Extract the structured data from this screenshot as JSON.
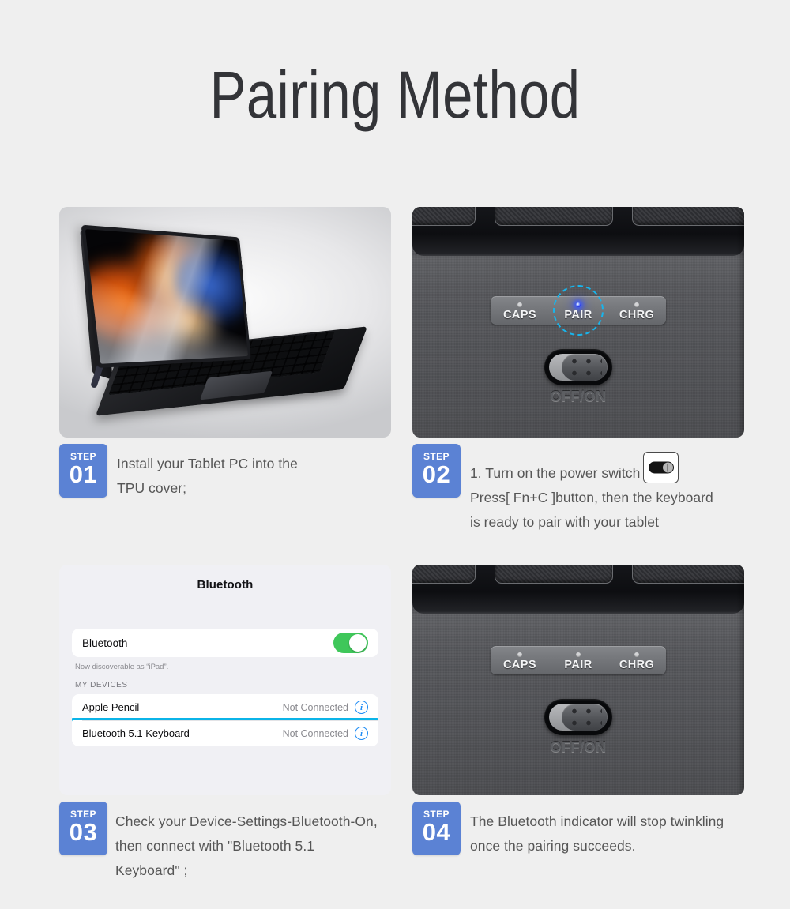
{
  "page": {
    "title": "Pairing Method",
    "background_color": "#efefef",
    "accent_color": "#5b82d4",
    "highlight_color": "#0bb4e8"
  },
  "steps": [
    {
      "badge_word": "STEP",
      "badge_number": "01",
      "caption_lines": [
        "Install your Tablet PC into the",
        "TPU cover;"
      ],
      "media": "tablet-in-keyboard-case-photo"
    },
    {
      "badge_word": "STEP",
      "badge_number": "02",
      "caption_part1": "1. Turn on the power switch",
      "caption_part2": "Press[ Fn+C ]button, then the keyboard",
      "caption_part3": "is ready to pair with your tablet",
      "media": "keyboard-indicator-macro-photo-pairing"
    },
    {
      "badge_word": "STEP",
      "badge_number": "03",
      "caption_lines": [
        "Check your Device-Settings-Bluetooth-On,",
        "then connect with \"Bluetooth 5.1",
        "Keyboard\" ;"
      ],
      "media": "ios-bluetooth-settings-screenshot"
    },
    {
      "badge_word": "STEP",
      "badge_number": "04",
      "caption_lines": [
        "The Bluetooth indicator will stop twinkling",
        "once the pairing succeeds."
      ],
      "media": "keyboard-indicator-macro-photo-paired"
    }
  ],
  "keyboard_photo": {
    "led_labels": [
      "CAPS",
      "PAIR",
      "CHRG"
    ],
    "switch_label": "OFF/ON",
    "pairing_led_state": "blinking-blue",
    "paired_led_state": "off",
    "pair_highlight_ring": true,
    "led_lit_color": "#2b3ff0"
  },
  "bluetooth_settings": {
    "title": "Bluetooth",
    "master_row_label": "Bluetooth",
    "master_toggle_state": "on",
    "master_toggle_color": "#3fc75a",
    "discoverable_note": "Now discoverable as “iPad”.",
    "section_title": "MY DEVICES",
    "devices": [
      {
        "name": "Apple Pencil",
        "status": "Not Connected",
        "info_icon": "info-circle-icon",
        "highlighted": false
      },
      {
        "name": "Bluetooth 5.1 Keyboard",
        "status": "Not Connected",
        "info_icon": "info-circle-icon",
        "highlighted": true
      }
    ]
  }
}
